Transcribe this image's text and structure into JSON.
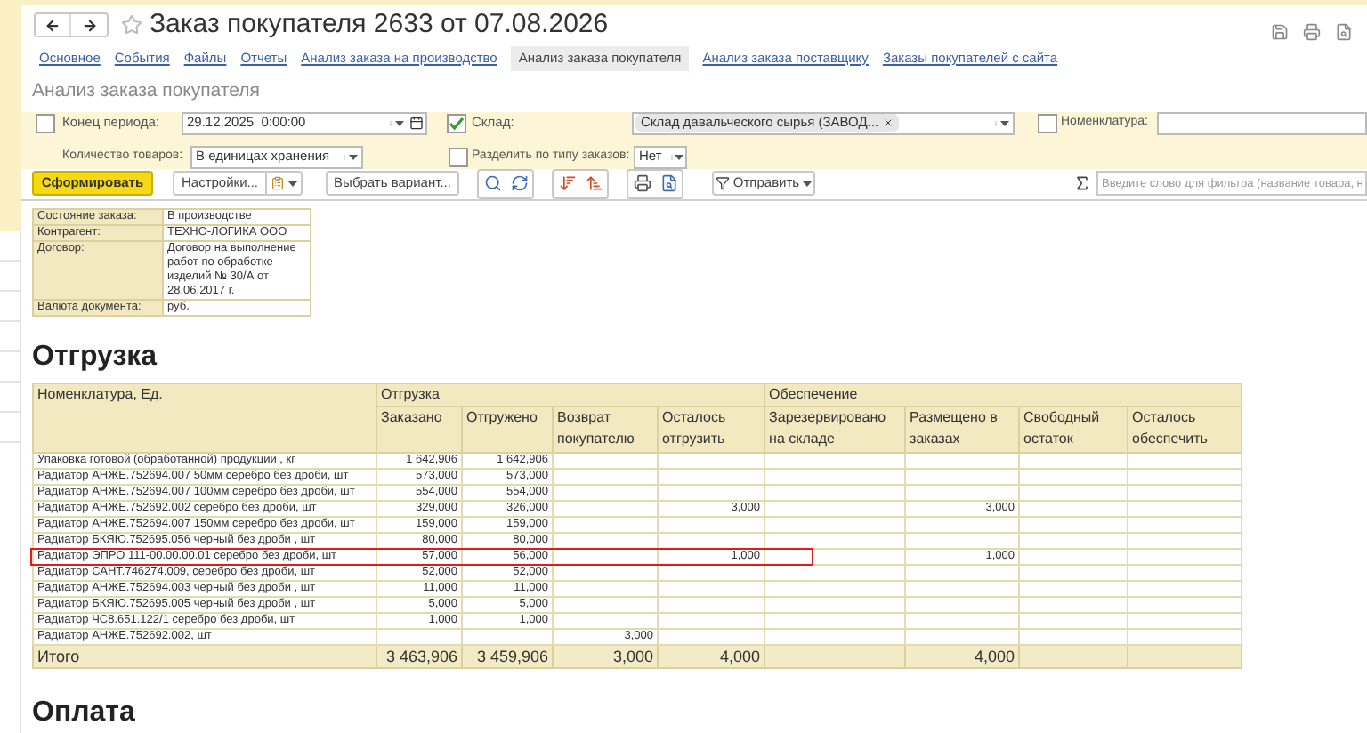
{
  "window": {
    "title": "Заказ покупателя 2633 от 07.08.2026"
  },
  "tabs": [
    {
      "label": "Основное",
      "selected": false
    },
    {
      "label": "События",
      "selected": false
    },
    {
      "label": "Файлы",
      "selected": false
    },
    {
      "label": "Отчеты",
      "selected": false
    },
    {
      "label": "Анализ заказа на производство",
      "selected": false
    },
    {
      "label": "Анализ заказа покупателя",
      "selected": true
    },
    {
      "label": "Анализ заказа поставщику",
      "selected": false
    },
    {
      "label": "Заказы покупателей с сайта",
      "selected": false
    }
  ],
  "report_title": "Анализ заказа покупателя",
  "filters": {
    "period_end": {
      "checked": false,
      "label": "Конец периода:",
      "value": "29.12.2025  0:00:00"
    },
    "warehouse": {
      "checked": true,
      "label": "Склад:",
      "tag": "Склад давальческого сырья (ЗАВОД..."
    },
    "nomenclature": {
      "checked": false,
      "label": "Номенклатура:"
    },
    "quantity": {
      "label": "Количество товаров:",
      "value": "В единицах хранения"
    },
    "split": {
      "checked": false,
      "label": "Разделить по типу заказов:",
      "value": "Нет"
    }
  },
  "toolbar": {
    "generate": "Сформировать",
    "settings": "Настройки...",
    "variant": "Выбрать вариант...",
    "send": "Отправить",
    "search_placeholder": "Введите слово для фильтра (название товара, н"
  },
  "order_info": [
    {
      "label": "Состояние заказа:",
      "value": "В производстве"
    },
    {
      "label": "Контрагент:",
      "value": "ТЕХНО-ЛОГИКА ООО"
    },
    {
      "label": "Договор:",
      "value": "Договор на выполнение работ по обработке изделий № 30/А от 28.06.2017 г."
    },
    {
      "label": "Валюта документа:",
      "value": "руб."
    }
  ],
  "shipment": {
    "heading": "Отгрузка",
    "name_column": "Номенклатура, Ед.",
    "column_groups": [
      {
        "label": "Отгрузка",
        "columns": [
          "Заказано",
          "Отгружено",
          "Возврат покупателю",
          "Осталось отгрузить"
        ]
      },
      {
        "label": "Обеспечение",
        "columns": [
          "Зарезервировано на складе",
          "Размещено в заказах",
          "Свободный остаток",
          "Осталось обеспечить"
        ]
      }
    ],
    "rows": [
      {
        "name": "Упаковка готовой (обработанной) продукции , кг",
        "ordered": "1 642,906",
        "shipped": "1 642,906",
        "highlighted": false
      },
      {
        "name": "Радиатор АНЖЕ.752694.007 50мм серебро без дроби, шт",
        "ordered": "573,000",
        "shipped": "573,000",
        "highlighted": false
      },
      {
        "name": "Радиатор АНЖЕ.752694.007 100мм серебро без дроби, шт",
        "ordered": "554,000",
        "shipped": "554,000",
        "highlighted": false
      },
      {
        "name": "Радиатор АНЖЕ.752692.002 серебро без дроби, шт",
        "ordered": "329,000",
        "shipped": "326,000",
        "to_ship": "3,000",
        "placed": "3,000",
        "highlighted": false
      },
      {
        "name": "Радиатор АНЖЕ.752694.007 150мм серебро без дроби, шт",
        "ordered": "159,000",
        "shipped": "159,000",
        "highlighted": false
      },
      {
        "name": "Радиатор БКЯЮ.752695.056 черный без дроби , шт",
        "ordered": "80,000",
        "shipped": "80,000",
        "highlighted": false
      },
      {
        "name": "Радиатор ЭПРО 111-00.00.00.01 серебро без дроби, шт",
        "ordered": "57,000",
        "shipped": "56,000",
        "to_ship": "1,000",
        "placed": "1,000",
        "highlighted": true
      },
      {
        "name": "Радиатор САНТ.746274.009, серебро без дроби, шт",
        "ordered": "52,000",
        "shipped": "52,000",
        "highlighted": false
      },
      {
        "name": "Радиатор АНЖЕ.752694.003 черный без дроби , шт",
        "ordered": "11,000",
        "shipped": "11,000",
        "highlighted": false
      },
      {
        "name": "Радиатор БКЯЮ.752695.005 черный без дроби , шт",
        "ordered": "5,000",
        "shipped": "5,000",
        "highlighted": false
      },
      {
        "name": "Радиатор ЧС8.651.122/1 серебро без дроби, шт",
        "ordered": "1,000",
        "shipped": "1,000",
        "highlighted": false
      },
      {
        "name": "Радиатор АНЖЕ.752692.002, шт",
        "returned": "3,000",
        "highlighted": false
      }
    ],
    "total": {
      "name": "Итого",
      "ordered": "3 463,906",
      "shipped": "3 459,906",
      "returned": "3,000",
      "to_ship": "4,000",
      "placed": "4,000"
    }
  },
  "payment": {
    "heading": "Оплата"
  }
}
